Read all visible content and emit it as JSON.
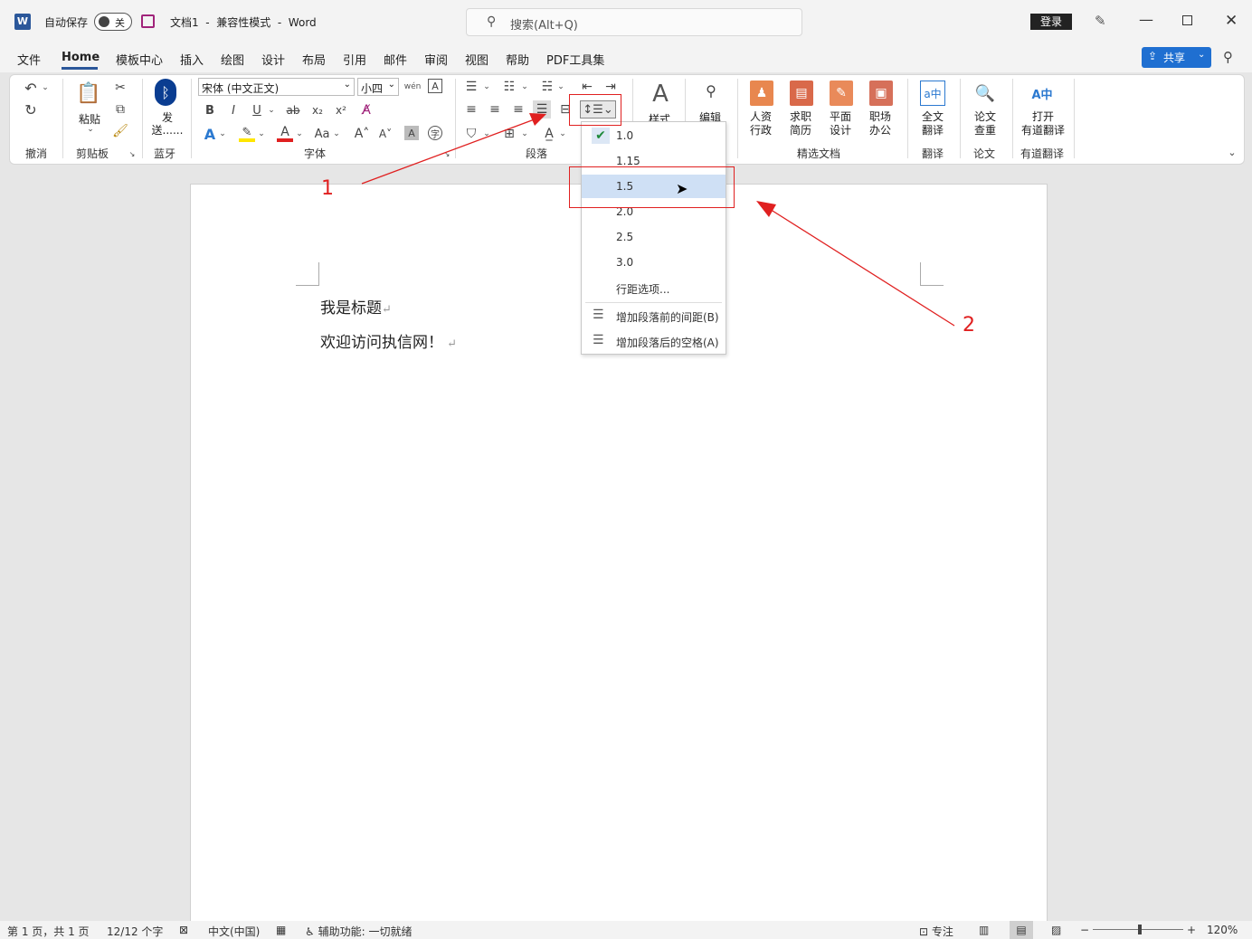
{
  "titlebar": {
    "autosave_label": "自动保存",
    "autosave_state": "关",
    "doc_title": "文档1  -  兼容性模式  -  Word",
    "search_placeholder": "搜索(Alt+Q)",
    "login": "登录"
  },
  "menu": [
    "文件",
    "Home",
    "模板中心",
    "插入",
    "绘图",
    "设计",
    "布局",
    "引用",
    "邮件",
    "审阅",
    "视图",
    "帮助",
    "PDF工具集"
  ],
  "share": "共享",
  "ribbon": {
    "undo_group": "撤消",
    "clipboard": {
      "paste": "粘贴",
      "group": "剪贴板"
    },
    "bluetooth": {
      "send": "发送......",
      "group": "蓝牙"
    },
    "font": {
      "name": "宋体 (中文正文)",
      "size": "小四",
      "group": "字体",
      "bold": "B",
      "italic": "I",
      "underline": "U",
      "strike": "ab",
      "sub": "x₂",
      "sup": "x²",
      "case": "Aa"
    },
    "paragraph_group": "段落",
    "styles": "样式",
    "editing": "编辑",
    "docs": {
      "hr": "人资\n行政",
      "resume": "求职\n简历",
      "design": "平面\n设计",
      "office": "职场\n办公",
      "group": "精选文档"
    },
    "translate": {
      "full": "全文\n翻译",
      "group": "翻译"
    },
    "paper": {
      "check": "论文\n查重",
      "group": "论文"
    },
    "youdao": {
      "open": "打开\n有道翻译",
      "group": "有道翻译"
    }
  },
  "document": {
    "line1": "我是标题",
    "line2": "欢迎访问执信网！"
  },
  "line_spacing_menu": {
    "items": [
      "1.0",
      "1.15",
      "1.5",
      "2.0",
      "2.5",
      "3.0",
      "行距选项..."
    ],
    "checked": "1.0",
    "hovered": "1.5",
    "add_before": "增加段落前的间距(B)",
    "add_after": "增加段落后的空格(A)"
  },
  "annotations": {
    "one": "1",
    "two": "2"
  },
  "statusbar": {
    "page": "第 1 页，共 1 页",
    "words": "12/12 个字",
    "lang": "中文(中国)",
    "accessibility": "辅助功能: 一切就绪",
    "focus": "专注",
    "zoom": "120%",
    "minus": "−",
    "plus": "+"
  },
  "colors": {
    "accent": "#2b579a",
    "share_bg": "#1f6fd1",
    "hover": "#cfe0f5",
    "annot_red": "#e02020"
  }
}
